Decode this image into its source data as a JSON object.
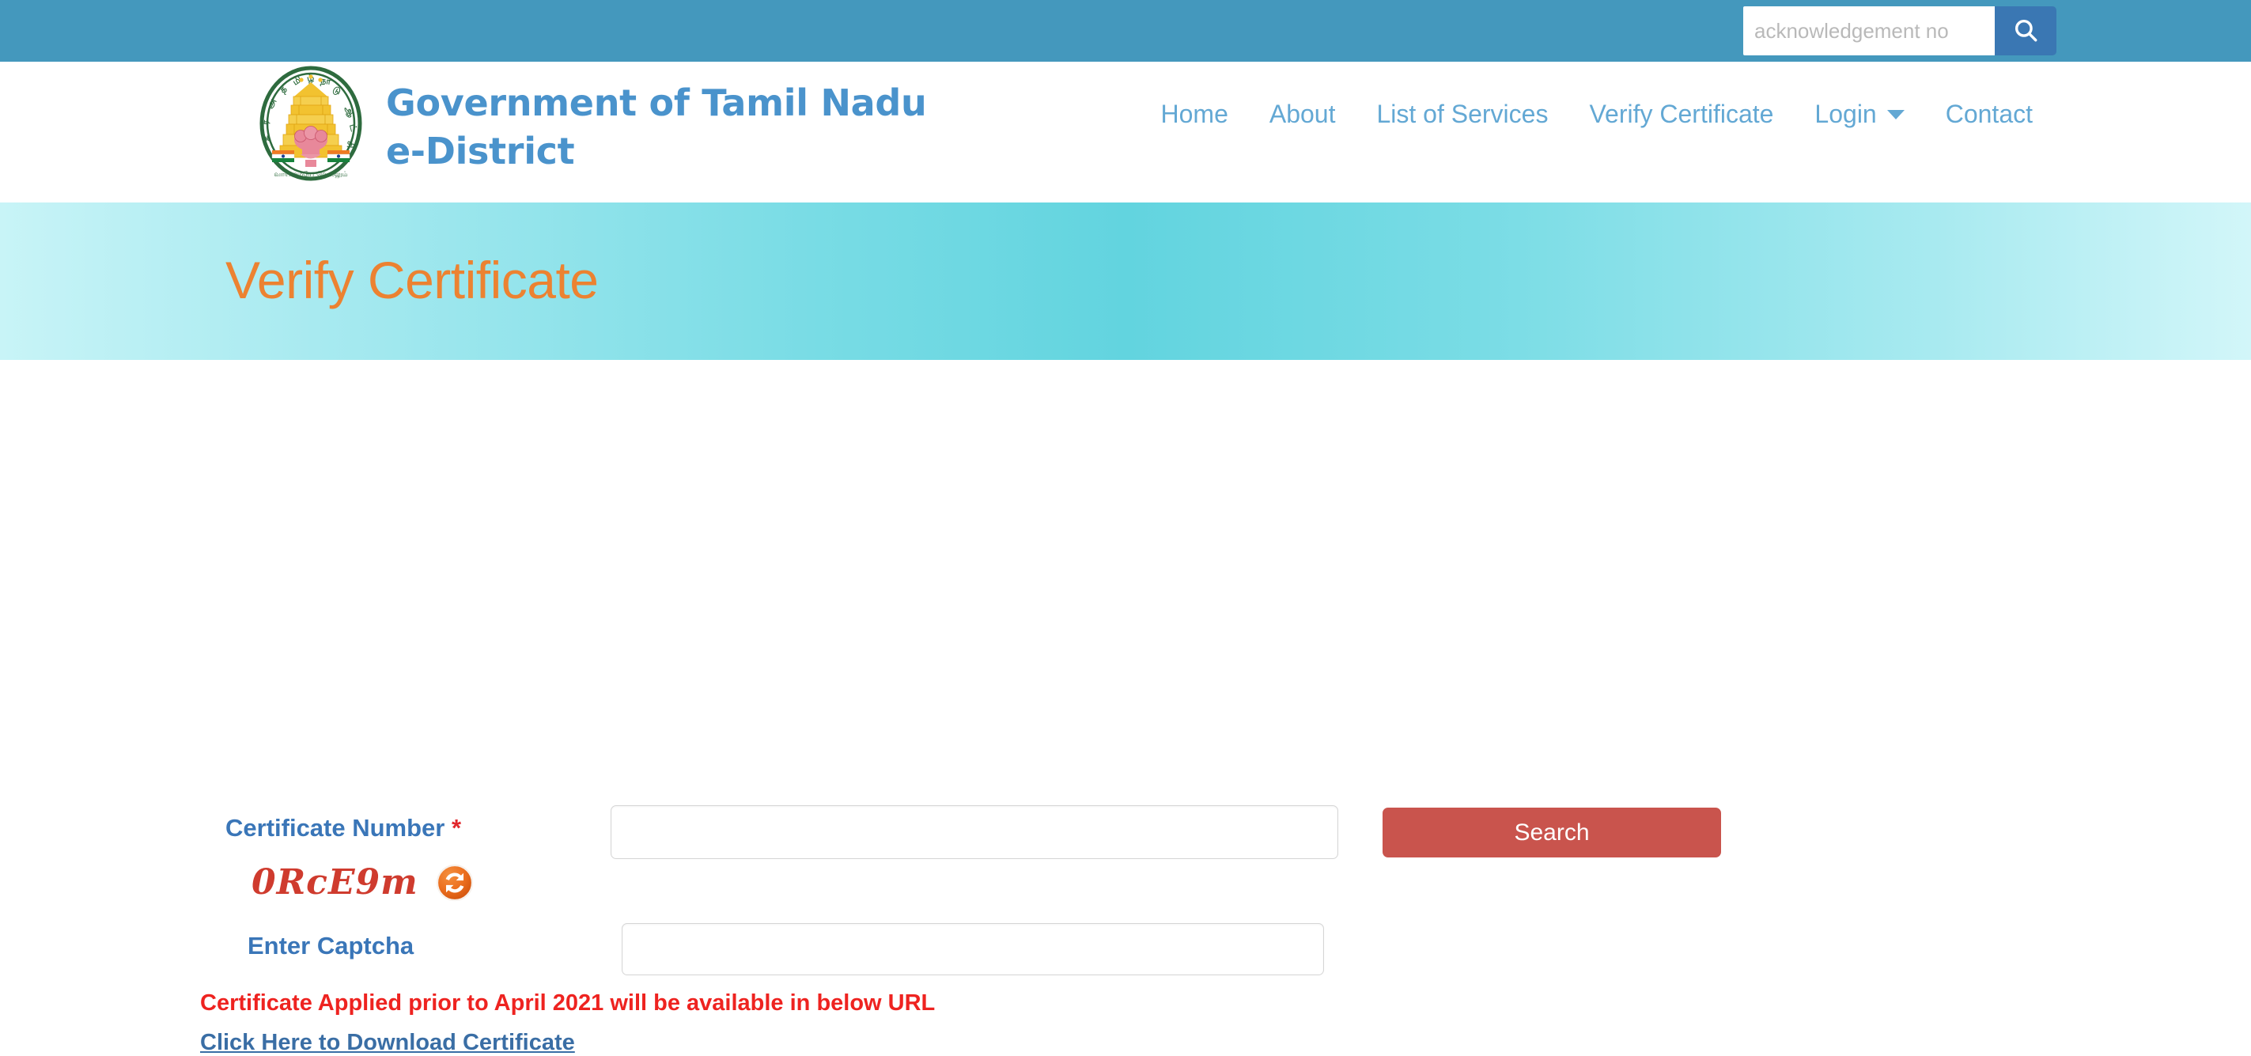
{
  "topbar": {
    "search": {
      "placeholder": "acknowledgement no",
      "value": "",
      "button_icon": "search-icon"
    },
    "background_color": "#4498bd",
    "button_color": "#3a77b3"
  },
  "header": {
    "logo": {
      "icon": "tamil-nadu-emblem",
      "alt": "Government of Tamil Nadu emblem"
    },
    "brand_line1": "Government of Tamil Nadu",
    "brand_line2": "e-District",
    "brand_color": "#4a93cc",
    "nav": [
      {
        "label": "Home",
        "has_caret": false
      },
      {
        "label": "About",
        "has_caret": false
      },
      {
        "label": "List of Services",
        "has_caret": false
      },
      {
        "label": "Verify Certificate",
        "has_caret": false
      },
      {
        "label": "Login",
        "has_caret": true
      },
      {
        "label": "Contact",
        "has_caret": false
      }
    ]
  },
  "banner": {
    "title": "Verify Certificate",
    "title_color": "#ec8231"
  },
  "form": {
    "certificate_number": {
      "label": "Certificate Number",
      "required_marker": "*",
      "placeholder": "",
      "value": ""
    },
    "captcha": {
      "code": "0RcE9m",
      "code_color": "#cf3b2e",
      "refresh_icon": "refresh-icon",
      "label": "Enter Captcha",
      "placeholder": "",
      "value": ""
    },
    "search_button": {
      "label": "Search",
      "color": "#c9544d"
    },
    "label_color": "#3a76b8"
  },
  "footer_notes": {
    "notice": "Certificate Applied prior to April 2021 will be available in below URL",
    "notice_color": "#ee2320",
    "link_text": "Click Here to Download Certificate",
    "link_color": "#3a6ea5"
  }
}
